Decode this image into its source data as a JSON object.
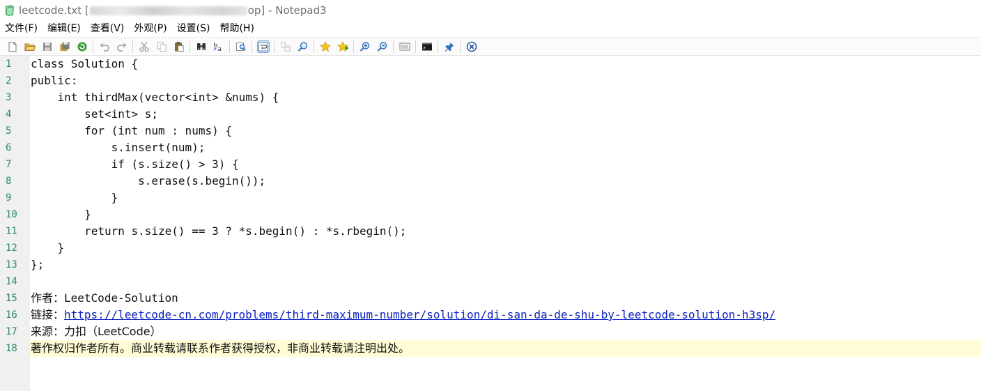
{
  "window": {
    "title_before": "leetcode.txt [",
    "title_after": "op] - Notepad3"
  },
  "menu": [
    "文件(F)",
    "编辑(E)",
    "查看(V)",
    "外观(P)",
    "设置(S)",
    "帮助(H)"
  ],
  "toolbar": {
    "icons": [
      "new-document-icon",
      "open-folder-icon",
      "save-disk-icon",
      "save-as-icon",
      "revert-icon",
      "undo-arrow-icon",
      "redo-arrow-icon",
      "cut-scissors-icon",
      "copy-icon",
      "paste-icon",
      "find-binoculars-icon",
      "replace-icon",
      "find-in-files-icon",
      "word-wrap-icon",
      "mark-occurrences-icon",
      "zoom-find-icon",
      "star-favorite-icon",
      "add-favorite-icon",
      "zoom-in-icon",
      "zoom-out-icon",
      "schema-icon",
      "console-icon",
      "pin-icon",
      "close-circle-icon"
    ],
    "active": "word-wrap-icon"
  },
  "editor": {
    "current_line": 18,
    "lines": [
      {
        "n": "1",
        "text": "class Solution {"
      },
      {
        "n": "2",
        "text": "public:"
      },
      {
        "n": "3",
        "text": "    int thirdMax(vector<int> &nums) {"
      },
      {
        "n": "4",
        "text": "        set<int> s;"
      },
      {
        "n": "5",
        "text": "        for (int num : nums) {"
      },
      {
        "n": "6",
        "text": "            s.insert(num);"
      },
      {
        "n": "7",
        "text": "            if (s.size() > 3) {"
      },
      {
        "n": "8",
        "text": "                s.erase(s.begin());"
      },
      {
        "n": "9",
        "text": "            }"
      },
      {
        "n": "10",
        "text": "        }"
      },
      {
        "n": "11",
        "text": "        return s.size() == 3 ? *s.begin() : *s.rbegin();"
      },
      {
        "n": "12",
        "text": "    }"
      },
      {
        "n": "13",
        "text": "};"
      },
      {
        "n": "14",
        "text": ""
      },
      {
        "n": "15",
        "label": "作者：",
        "rest": "LeetCode-Solution"
      },
      {
        "n": "16",
        "label": "链接：",
        "url": "https://leetcode-cn.com/problems/third-maximum-number/solution/di-san-da-de-shu-by-leetcode-solution-h3sp/"
      },
      {
        "n": "17",
        "label": "来源：",
        "label2": "力扣",
        "rest": "（LeetCode）"
      },
      {
        "n": "18",
        "label": "著作权归作者所有。商业转载请联系作者获得授权，非商业转载请注明出处。"
      }
    ]
  },
  "colors": {
    "line_number": "#2c8a6a",
    "gutter": "#f0f0f0",
    "current_line": "#fffcd6",
    "link": "#0b20c2"
  }
}
